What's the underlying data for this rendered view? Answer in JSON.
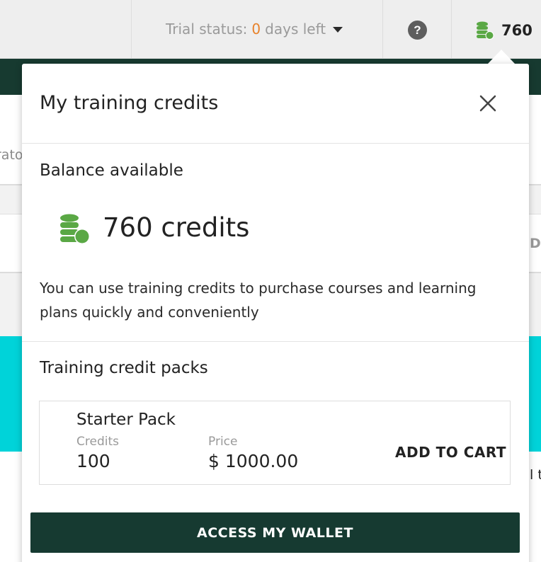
{
  "topbar": {
    "trial_label": "Trial status:",
    "trial_days": "0",
    "trial_suffix": "days left",
    "help_glyph": "?",
    "credits_count": "760"
  },
  "background": {
    "fragment_left": "rato",
    "fragment_right_1": "DI",
    "fragment_right_2": "l t"
  },
  "popup": {
    "title": "My training credits",
    "balance_heading": "Balance available",
    "balance_value": "760 credits",
    "description": "You can use training credits to purchase courses and learning plans quickly and conveniently",
    "packs_heading": "Training credit packs",
    "packs": [
      {
        "name": "Starter Pack",
        "credits_label": "Credits",
        "credits_value": "100",
        "price_label": "Price",
        "price_value": "$ 1000.00",
        "action_label": "ADD TO CART"
      }
    ],
    "wallet_button_label": "ACCESS MY WALLET"
  },
  "icons": {
    "coins": "coins-stack-icon",
    "close": "close-icon",
    "help": "help-icon",
    "caret": "caret-down-icon"
  },
  "colors": {
    "accent_green": "#5aa845",
    "dark_green": "#163a31",
    "trial_orange": "#e8822b",
    "cyan": "#00d3d9"
  }
}
